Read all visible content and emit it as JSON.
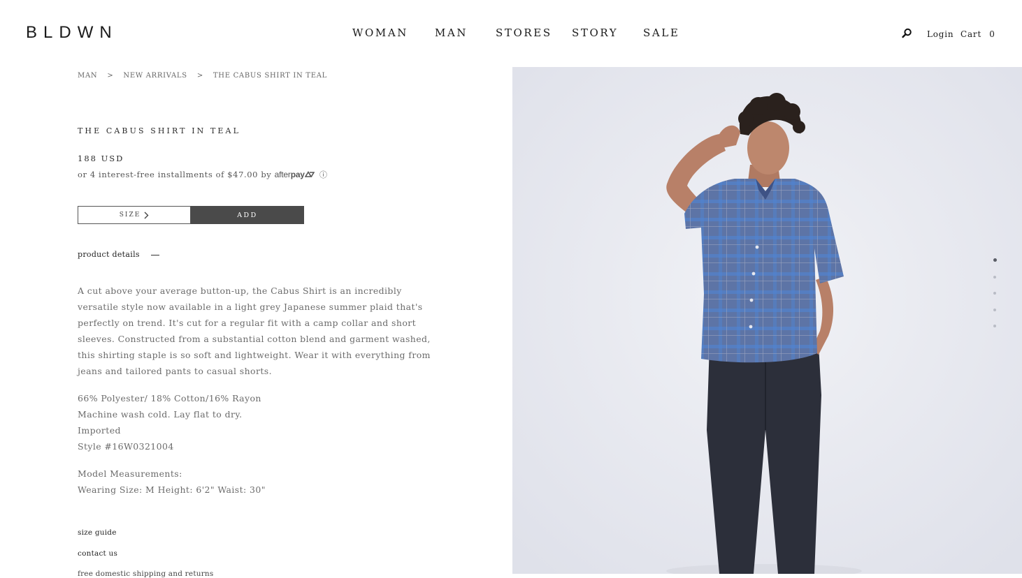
{
  "header": {
    "logo": "BLDWN",
    "nav": [
      "WOMAN",
      "MAN",
      "STORES",
      "STORY",
      "SALE"
    ],
    "login": "Login",
    "cart_label": "Cart",
    "cart_count": "0"
  },
  "breadcrumb": [
    "MAN",
    "NEW ARRIVALS",
    "THE CABUS SHIRT IN TEAL"
  ],
  "breadcrumb_sep": ">",
  "product": {
    "title": "THE CABUS SHIRT IN TEAL",
    "price": "188 USD",
    "installments_text": "or 4 interest-free installments of $47.00 by",
    "afterpay_after": "after",
    "afterpay_pay": "pay",
    "info_symbol": "ⓘ",
    "size_label": "SIZE",
    "add_label": "ADD",
    "details_label": "product details",
    "description": "A cut above your average button-up, the Cabus Shirt is an incredibly versatile style now available in a light grey Japanese summer plaid that's perfectly on trend. It's cut for a regular fit with a camp collar and short sleeves. Constructed from a substantial cotton blend and garment washed, this shirting staple is so soft and lightweight. Wear it with everything from jeans and tailored pants to casual shorts.",
    "specs": [
      "66% Polyester/ 18% Cotton/16% Rayon",
      "Machine wash cold. Lay flat to dry.",
      "Imported",
      "Style #16W0321004"
    ],
    "model_heading": "Model Measurements:",
    "model_values": "Wearing Size: M Height: 6'2\" Waist: 30\""
  },
  "links": {
    "size_guide": "size guide",
    "contact_us": "contact us",
    "partial": "free domestic shipping and returns"
  },
  "gallery": {
    "image_count": 5,
    "active_index": 0
  },
  "colors": {
    "add_button_bg": "#4a4a4a",
    "shirt": "#5d74a6",
    "pants": "#2c2f3a",
    "photo_bg": "#e8e9ef"
  }
}
